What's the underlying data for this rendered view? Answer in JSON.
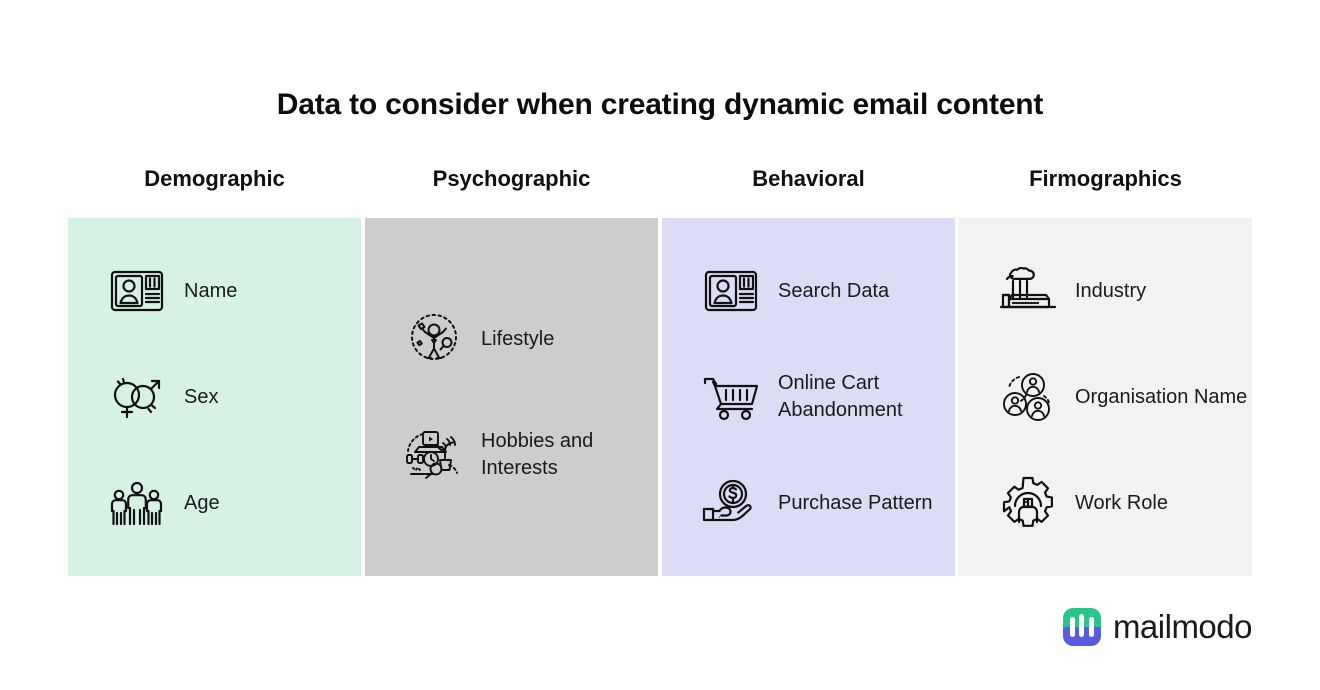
{
  "title": "Data to consider when creating dynamic email content",
  "colors": {
    "demographic_bg": "#D5F2E5",
    "psychographic_bg": "#CDCDCD",
    "behavioral_bg": "#DCDCF7",
    "firmographics_bg": "#F2F2F2",
    "text": "#1a1a1a",
    "brand_green": "#2BC48A",
    "brand_blue": "#5B5BE0"
  },
  "columns": [
    {
      "header": "Demographic",
      "bg": "#D5F2E5",
      "items": [
        {
          "label": "Name",
          "icon": "id-card-icon"
        },
        {
          "label": "Sex",
          "icon": "gender-symbols-icon"
        },
        {
          "label": "Age",
          "icon": "three-people-icon"
        }
      ]
    },
    {
      "header": "Psychographic",
      "bg": "#CDCDCD",
      "items": [
        {
          "label": "Lifestyle",
          "icon": "person-celebrating-icon"
        },
        {
          "label": "Hobbies and Interests",
          "icon": "hobbies-collage-icon"
        }
      ]
    },
    {
      "header": "Behavioral",
      "bg": "#DCDCF7",
      "items": [
        {
          "label": "Search Data",
          "icon": "id-card-icon"
        },
        {
          "label": "Online Cart Abandonment",
          "icon": "shopping-cart-icon"
        },
        {
          "label": "Purchase Pattern",
          "icon": "hand-holding-coin-icon"
        }
      ]
    },
    {
      "header": "Firmographics",
      "bg": "#F2F2F2",
      "items": [
        {
          "label": "Industry",
          "icon": "factory-icon"
        },
        {
          "label": "Organisation Name",
          "icon": "people-group-icon"
        },
        {
          "label": "Work Role",
          "icon": "gear-person-icon"
        }
      ]
    }
  ],
  "brand": {
    "name": "mailmodo",
    "mark": "mailmodo-logo-mark"
  }
}
